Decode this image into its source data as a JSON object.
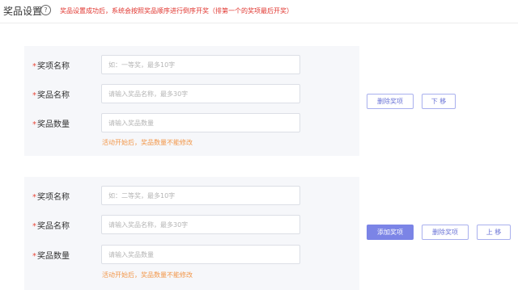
{
  "header": {
    "title": "奖品设置",
    "help_glyph": "?",
    "notice": "奖品设置成功后，系统会按照奖品顺序进行倒序开奖（排第一个的奖项最后开奖）"
  },
  "required_mark": "*",
  "prize_1": {
    "award_name_label": "奖项名称",
    "award_name_placeholder": "如：一等奖，最多10字",
    "prize_name_label": "奖品名称",
    "prize_name_placeholder": "请输入奖品名称，最多30字",
    "quantity_label": "奖品数量",
    "quantity_placeholder": "请输入奖品数量",
    "hint": "活动开始后，奖品数量不能修改",
    "buttons": {
      "delete": "删除奖项",
      "move_down": "下 移"
    }
  },
  "prize_2": {
    "award_name_label": "奖项名称",
    "award_name_placeholder": "如：二等奖，最多10字",
    "prize_name_label": "奖品名称",
    "prize_name_placeholder": "请输入奖品名称，最多30字",
    "quantity_label": "奖品数量",
    "quantity_placeholder": "请输入奖品数量",
    "hint": "活动开始后，奖品数量不能修改",
    "buttons": {
      "add": "添加奖项",
      "delete": "删除奖项",
      "move_up": "上 移"
    }
  },
  "colors": {
    "accent": "#7b84e6",
    "required": "#e84a3c",
    "notice": "#e0342e",
    "hint": "#f2974a",
    "card_bg": "#f6f7fa"
  },
  "icons": {
    "help": "help-circle-icon"
  }
}
